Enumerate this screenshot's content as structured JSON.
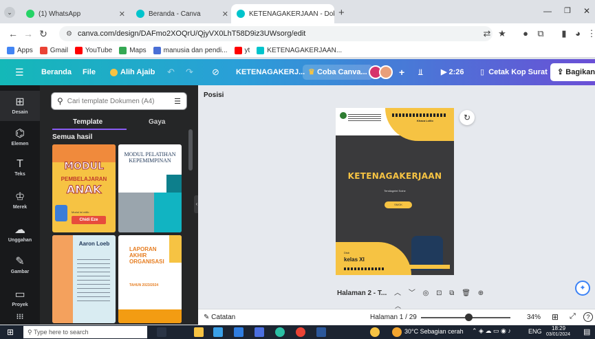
{
  "browser": {
    "tabs": [
      {
        "title": "(1) WhatsApp",
        "color": "#25d366"
      },
      {
        "title": "Beranda - Canva",
        "color": "#00c4cc"
      },
      {
        "title": "KETENAGAKERJAAN - Dokume",
        "color": "#00c4cc"
      }
    ],
    "new_tab": "+",
    "url": "canva.com/design/DAFmo2XOQrU/QjyVX0LhT58D9iz3UWsorg/edit",
    "bookmarks": [
      {
        "label": "Apps",
        "color": "#4285f4"
      },
      {
        "label": "Gmail",
        "color": "#ea4335"
      },
      {
        "label": "YouTube",
        "color": "#ff0000"
      },
      {
        "label": "Maps",
        "color": "#34a853"
      },
      {
        "label": "manusia dan pendi...",
        "color": "#4a6fd6"
      },
      {
        "label": "yt",
        "color": "#ff0000"
      },
      {
        "label": "KETENAGAKERJAAN...",
        "color": "#00c4cc"
      }
    ]
  },
  "canva_header": {
    "home": "Beranda",
    "file": "File",
    "magic": "Alih Ajaib",
    "doc_title": "KETENAGAKERJ...",
    "trial": "Coba Canva...",
    "timer": "2:26",
    "print": "Cetak Kop Surat",
    "share": "Bagikan"
  },
  "rail": [
    {
      "label": "Desain",
      "icon": "layout-icon",
      "glyph": "⊞"
    },
    {
      "label": "Elemen",
      "icon": "elements-icon",
      "glyph": "⌬"
    },
    {
      "label": "Teks",
      "icon": "text-icon",
      "glyph": "T"
    },
    {
      "label": "Merek",
      "icon": "brand-icon",
      "glyph": "♔"
    },
    {
      "label": "Unggahan",
      "icon": "upload-icon",
      "glyph": "☁"
    },
    {
      "label": "Gambar",
      "icon": "draw-icon",
      "glyph": "✎"
    },
    {
      "label": "Proyek",
      "icon": "folder-icon",
      "glyph": "▭"
    }
  ],
  "panel": {
    "search_placeholder": "Cari template Dokumen (A4)",
    "tab_template": "Template",
    "tab_style": "Gaya",
    "all_results": "Semua hasil",
    "templates": [
      {
        "title": "MODUL",
        "subtitle": "PEMBELAJARAN",
        "title2": "ANAK",
        "badge": "Modul ini milik :",
        "name": "Chidi Eze",
        "bg": "#f6c343"
      },
      {
        "title": "MODUL PELATIHAN KEPEMIMPINAN",
        "bg": "#ffffff"
      },
      {
        "title": "Aaron Loeb",
        "bg": "#d9ecf2"
      },
      {
        "title": "LAPORAN AKHIR ORGANISASI",
        "year": "TAHUN 2023/2024",
        "bg": "#ffffff"
      }
    ]
  },
  "canvas": {
    "position_label": "Posisi",
    "page": {
      "title": "KETENAGAKERJAAN",
      "subtitle": "Tersilagntei  Solne",
      "button": "SMOK",
      "footer_small": "Disb",
      "footer_big": "kelas XI",
      "header_right": "Khaca Lolilo",
      "accent": "#f6c343"
    },
    "page_nav": "Halaman 2 - T..."
  },
  "status": {
    "notes": "Catatan",
    "page_count": "Halaman 1 / 29",
    "zoom": "34%",
    "zoom_fraction": 0.34
  },
  "taskbar": {
    "search": "Type here to search",
    "weather": "30°C  Sebagian cerah",
    "lang": "ENG",
    "time": "18:29",
    "date": "03/01/2024"
  }
}
